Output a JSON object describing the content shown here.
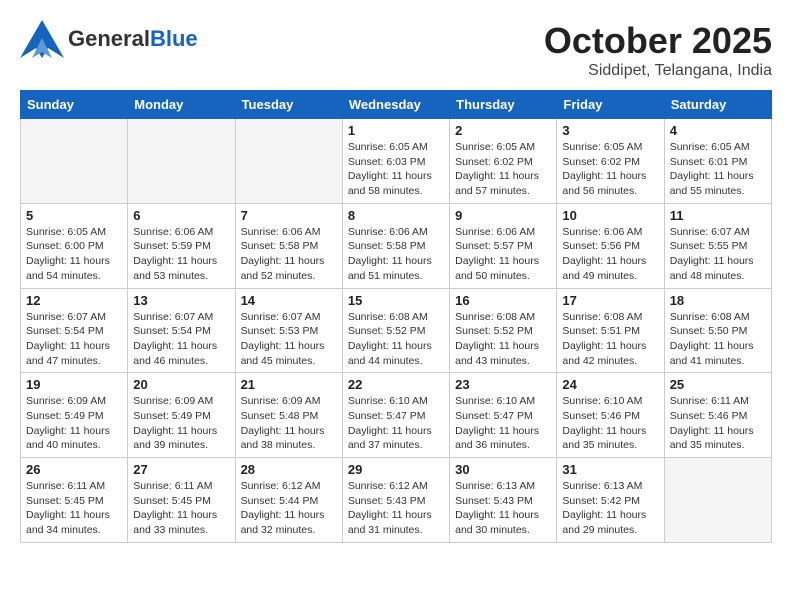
{
  "logo": {
    "general": "General",
    "blue": "Blue"
  },
  "title": "October 2025",
  "subtitle": "Siddipet, Telangana, India",
  "days_header": [
    "Sunday",
    "Monday",
    "Tuesday",
    "Wednesday",
    "Thursday",
    "Friday",
    "Saturday"
  ],
  "weeks": [
    [
      {
        "day": "",
        "info": ""
      },
      {
        "day": "",
        "info": ""
      },
      {
        "day": "",
        "info": ""
      },
      {
        "day": "1",
        "info": "Sunrise: 6:05 AM\nSunset: 6:03 PM\nDaylight: 11 hours\nand 58 minutes."
      },
      {
        "day": "2",
        "info": "Sunrise: 6:05 AM\nSunset: 6:02 PM\nDaylight: 11 hours\nand 57 minutes."
      },
      {
        "day": "3",
        "info": "Sunrise: 6:05 AM\nSunset: 6:02 PM\nDaylight: 11 hours\nand 56 minutes."
      },
      {
        "day": "4",
        "info": "Sunrise: 6:05 AM\nSunset: 6:01 PM\nDaylight: 11 hours\nand 55 minutes."
      }
    ],
    [
      {
        "day": "5",
        "info": "Sunrise: 6:05 AM\nSunset: 6:00 PM\nDaylight: 11 hours\nand 54 minutes."
      },
      {
        "day": "6",
        "info": "Sunrise: 6:06 AM\nSunset: 5:59 PM\nDaylight: 11 hours\nand 53 minutes."
      },
      {
        "day": "7",
        "info": "Sunrise: 6:06 AM\nSunset: 5:58 PM\nDaylight: 11 hours\nand 52 minutes."
      },
      {
        "day": "8",
        "info": "Sunrise: 6:06 AM\nSunset: 5:58 PM\nDaylight: 11 hours\nand 51 minutes."
      },
      {
        "day": "9",
        "info": "Sunrise: 6:06 AM\nSunset: 5:57 PM\nDaylight: 11 hours\nand 50 minutes."
      },
      {
        "day": "10",
        "info": "Sunrise: 6:06 AM\nSunset: 5:56 PM\nDaylight: 11 hours\nand 49 minutes."
      },
      {
        "day": "11",
        "info": "Sunrise: 6:07 AM\nSunset: 5:55 PM\nDaylight: 11 hours\nand 48 minutes."
      }
    ],
    [
      {
        "day": "12",
        "info": "Sunrise: 6:07 AM\nSunset: 5:54 PM\nDaylight: 11 hours\nand 47 minutes."
      },
      {
        "day": "13",
        "info": "Sunrise: 6:07 AM\nSunset: 5:54 PM\nDaylight: 11 hours\nand 46 minutes."
      },
      {
        "day": "14",
        "info": "Sunrise: 6:07 AM\nSunset: 5:53 PM\nDaylight: 11 hours\nand 45 minutes."
      },
      {
        "day": "15",
        "info": "Sunrise: 6:08 AM\nSunset: 5:52 PM\nDaylight: 11 hours\nand 44 minutes."
      },
      {
        "day": "16",
        "info": "Sunrise: 6:08 AM\nSunset: 5:52 PM\nDaylight: 11 hours\nand 43 minutes."
      },
      {
        "day": "17",
        "info": "Sunrise: 6:08 AM\nSunset: 5:51 PM\nDaylight: 11 hours\nand 42 minutes."
      },
      {
        "day": "18",
        "info": "Sunrise: 6:08 AM\nSunset: 5:50 PM\nDaylight: 11 hours\nand 41 minutes."
      }
    ],
    [
      {
        "day": "19",
        "info": "Sunrise: 6:09 AM\nSunset: 5:49 PM\nDaylight: 11 hours\nand 40 minutes."
      },
      {
        "day": "20",
        "info": "Sunrise: 6:09 AM\nSunset: 5:49 PM\nDaylight: 11 hours\nand 39 minutes."
      },
      {
        "day": "21",
        "info": "Sunrise: 6:09 AM\nSunset: 5:48 PM\nDaylight: 11 hours\nand 38 minutes."
      },
      {
        "day": "22",
        "info": "Sunrise: 6:10 AM\nSunset: 5:47 PM\nDaylight: 11 hours\nand 37 minutes."
      },
      {
        "day": "23",
        "info": "Sunrise: 6:10 AM\nSunset: 5:47 PM\nDaylight: 11 hours\nand 36 minutes."
      },
      {
        "day": "24",
        "info": "Sunrise: 6:10 AM\nSunset: 5:46 PM\nDaylight: 11 hours\nand 35 minutes."
      },
      {
        "day": "25",
        "info": "Sunrise: 6:11 AM\nSunset: 5:46 PM\nDaylight: 11 hours\nand 35 minutes."
      }
    ],
    [
      {
        "day": "26",
        "info": "Sunrise: 6:11 AM\nSunset: 5:45 PM\nDaylight: 11 hours\nand 34 minutes."
      },
      {
        "day": "27",
        "info": "Sunrise: 6:11 AM\nSunset: 5:45 PM\nDaylight: 11 hours\nand 33 minutes."
      },
      {
        "day": "28",
        "info": "Sunrise: 6:12 AM\nSunset: 5:44 PM\nDaylight: 11 hours\nand 32 minutes."
      },
      {
        "day": "29",
        "info": "Sunrise: 6:12 AM\nSunset: 5:43 PM\nDaylight: 11 hours\nand 31 minutes."
      },
      {
        "day": "30",
        "info": "Sunrise: 6:13 AM\nSunset: 5:43 PM\nDaylight: 11 hours\nand 30 minutes."
      },
      {
        "day": "31",
        "info": "Sunrise: 6:13 AM\nSunset: 5:42 PM\nDaylight: 11 hours\nand 29 minutes."
      },
      {
        "day": "",
        "info": ""
      }
    ]
  ]
}
